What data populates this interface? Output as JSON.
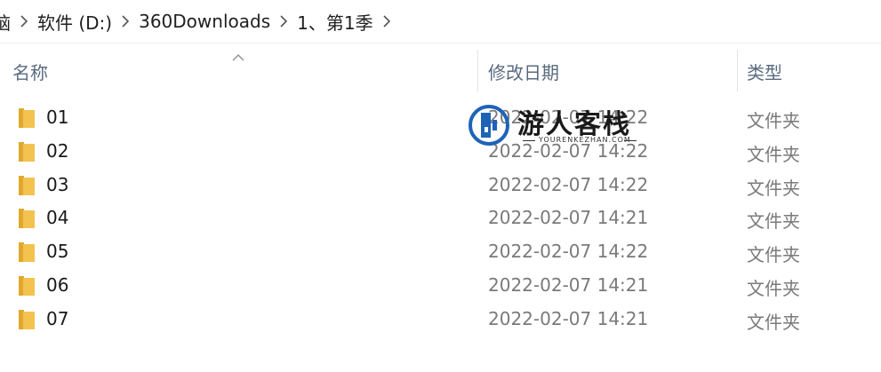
{
  "breadcrumb": {
    "items": [
      "脑",
      "软件 (D:)",
      "360Downloads",
      "1、第1季"
    ]
  },
  "columns": {
    "name": "名称",
    "date": "修改日期",
    "type": "类型"
  },
  "rows": [
    {
      "name": "01",
      "date": "2022-02-07 14:22",
      "type": "文件夹"
    },
    {
      "name": "02",
      "date": "2022-02-07 14:22",
      "type": "文件夹"
    },
    {
      "name": "03",
      "date": "2022-02-07 14:22",
      "type": "文件夹"
    },
    {
      "name": "04",
      "date": "2022-02-07 14:21",
      "type": "文件夹"
    },
    {
      "name": "05",
      "date": "2022-02-07 14:22",
      "type": "文件夹"
    },
    {
      "name": "06",
      "date": "2022-02-07 14:21",
      "type": "文件夹"
    },
    {
      "name": "07",
      "date": "2022-02-07 14:21",
      "type": "文件夹"
    }
  ],
  "watermark": {
    "title": "游人客栈",
    "subtitle": "YOURENKEZHAN.COM"
  },
  "colors": {
    "folder": "#f3c24f",
    "folder_dark": "#e0a82e",
    "header_text": "#5a6b80",
    "muted_text": "#7a7a7a",
    "logo_blue": "#1e63b8"
  },
  "icons": {
    "separator": "chevron-right-icon",
    "sort": "sort-ascending-icon",
    "folder": "folder-icon"
  }
}
